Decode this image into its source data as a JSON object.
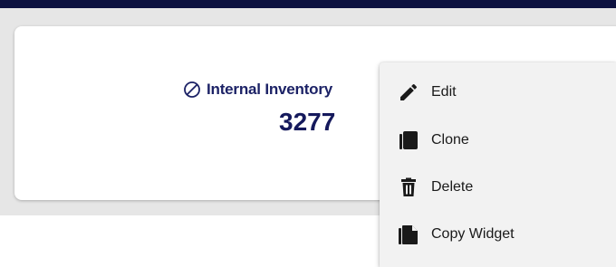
{
  "colors": {
    "top_bar": "#0d1240",
    "page_background": "#e6e6e6",
    "card_background": "#ffffff",
    "title_text": "#1c2266",
    "value_text": "#15195c",
    "menu_background": "#f2f2f2",
    "menu_icon": "#1a1a1a"
  },
  "widget": {
    "icon": "disabled-circle-icon",
    "title": "Internal Inventory",
    "value": "3277"
  },
  "context_menu": {
    "items": [
      {
        "label": "Edit",
        "icon": "pencil-icon"
      },
      {
        "label": "Clone",
        "icon": "clone-icon"
      },
      {
        "label": "Delete",
        "icon": "trash-icon"
      },
      {
        "label": "Copy Widget",
        "icon": "file-copy-icon"
      }
    ]
  }
}
